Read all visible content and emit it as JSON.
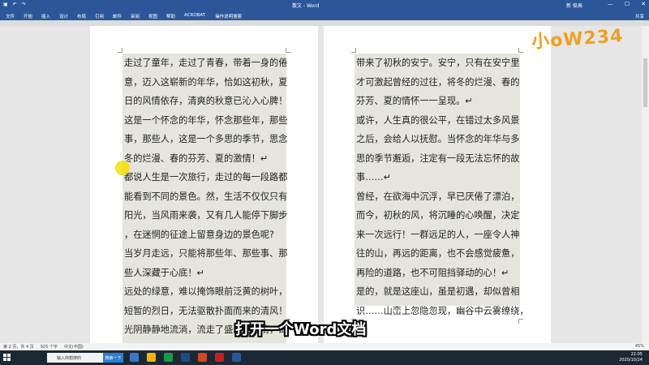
{
  "titlebar": {
    "doc_title": "散文 - Word",
    "user": "新 俊高",
    "share_label": "共享"
  },
  "ribbon": {
    "tabs": [
      "文件",
      "开始",
      "插入",
      "设计",
      "布局",
      "引用",
      "邮件",
      "审阅",
      "视图",
      "帮助",
      "ACROBAT",
      "操作说明搜索"
    ]
  },
  "page1_lines": [
    "走过了童年，走过了青春，带着一身的倦",
    "意，迈入这崭新的年华，恰如这初秋，夏",
    "日的风情依存，清爽的秋意已沁入心脾！",
    "这是一个怀念的年华，怀念那些年，那些",
    "事，那些人，这是一个多思的季节，思念",
    "冬的烂漫、春的芬芳、夏的激情！↵",
    "都说人生是一次旅行，走过的每一段路都",
    "能看到不同的景色。然，生活不仅仅只有",
    "阳光，当风雨来袭，又有几人能停下脚步",
    "，在迷惘的征途上留意身边的景色呢?",
    "当岁月走远，只能将那些年、那些事、那",
    "些人深藏于心底！↵",
    "远处的绿意，难以掩饰眼前泛黄的树叶，",
    "短暂的烈日，无法驱散扑面而来的清风！",
    "光阴静静地流淌，流走了盛夏的激情，却"
  ],
  "page2_lines": [
    "带来了初秋的安宁。安宁，只有在安宁里",
    "才可激起曾经的过往，将冬的烂漫、春的",
    "芬芳、夏的情怀一一呈现。↵",
    "或许，人生真的很公平，在错过太多风景",
    "之后，会给人以抚慰。当怀念的年华与多",
    "思的季节邂逅，注定有一段无法忘怀的故",
    "事……↵",
    "曾经，在欲海中沉浮，早已厌倦了漂泊，",
    "而今，初秋的风，将沉睡的心唤醒，决定",
    "来一次远行！一群远足的人，一座令人神",
    "往的山，再远的距离，也不会感觉疲惫，",
    "再险的道路，也不可阻挡驿动的心！↵",
    "是的，就是这座山，虽是初遇，却似曾相",
    "识……山峦上忽隐忽现，幽谷中云雾缭绕，"
  ],
  "subtitle": "打开一个Word文档",
  "logo_text": "小oW234",
  "statusbar": {
    "page": "第 2 页，共 4 页",
    "words": "925 个字",
    "lang": "中文(中国)",
    "zoom": "45%"
  },
  "taskbar": {
    "search_placeholder": "输入你想搜的",
    "search_button": "搜索一下",
    "time": "22:05",
    "date": "2020/10/24"
  },
  "colors": {
    "word_blue": "#2b579a",
    "highlight": "#e5e5dd",
    "cursor": "#f3e000"
  }
}
